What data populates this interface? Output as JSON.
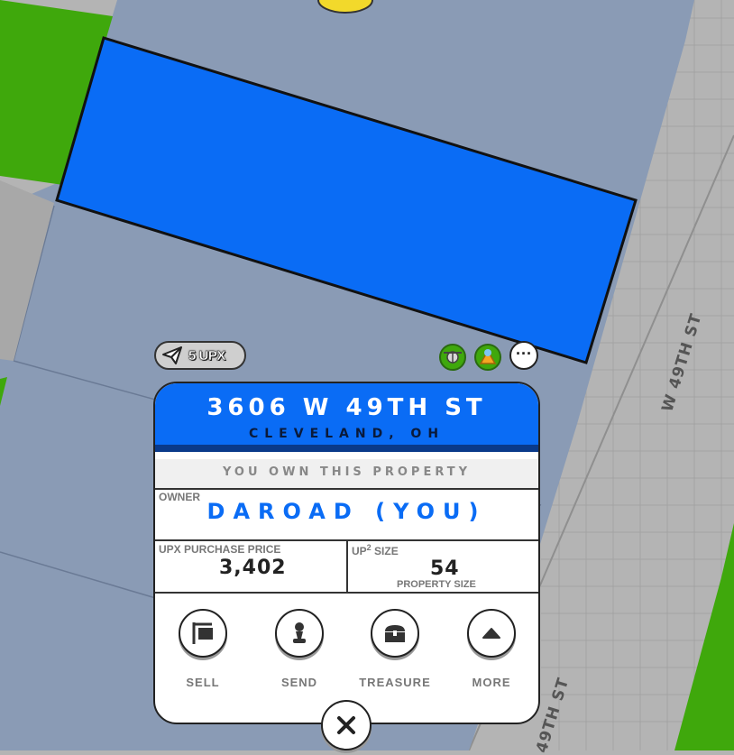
{
  "map": {
    "street_label_east": "W 49TH ST",
    "street_label_south": "49TH ST"
  },
  "wallet": {
    "amount_label": "5 UPX"
  },
  "map_icons": [
    "drone-icon",
    "terrain-icon",
    "more-options-icon"
  ],
  "property": {
    "address": "3606 W 49TH ST",
    "city": "CLEVELAND, OH",
    "ownership_status": "YOU OWN THIS PROPERTY",
    "owner_label": "OWNER",
    "owner_value": "DAROAD (YOU)",
    "price_label": "UPX PURCHASE PRICE",
    "price_value": "3,402",
    "size_label_prefix": "UP",
    "size_label_sup": "2",
    "size_label_suffix": " SIZE",
    "size_value": "54",
    "size_caption": "PROPERTY SIZE"
  },
  "actions": [
    {
      "label": "SELL",
      "icon": "sign-icon"
    },
    {
      "label": "SEND",
      "icon": "chess-pawn-icon"
    },
    {
      "label": "TREASURE",
      "icon": "treasure-chest-icon"
    },
    {
      "label": "MORE",
      "icon": "triangle-up-icon"
    }
  ],
  "close": {
    "icon": "close-icon"
  },
  "colors": {
    "selected_parcel": "#0a6cf5",
    "parcel": "#8a9bb5",
    "park": "#3fa80c",
    "road": "#b4b4b4"
  }
}
